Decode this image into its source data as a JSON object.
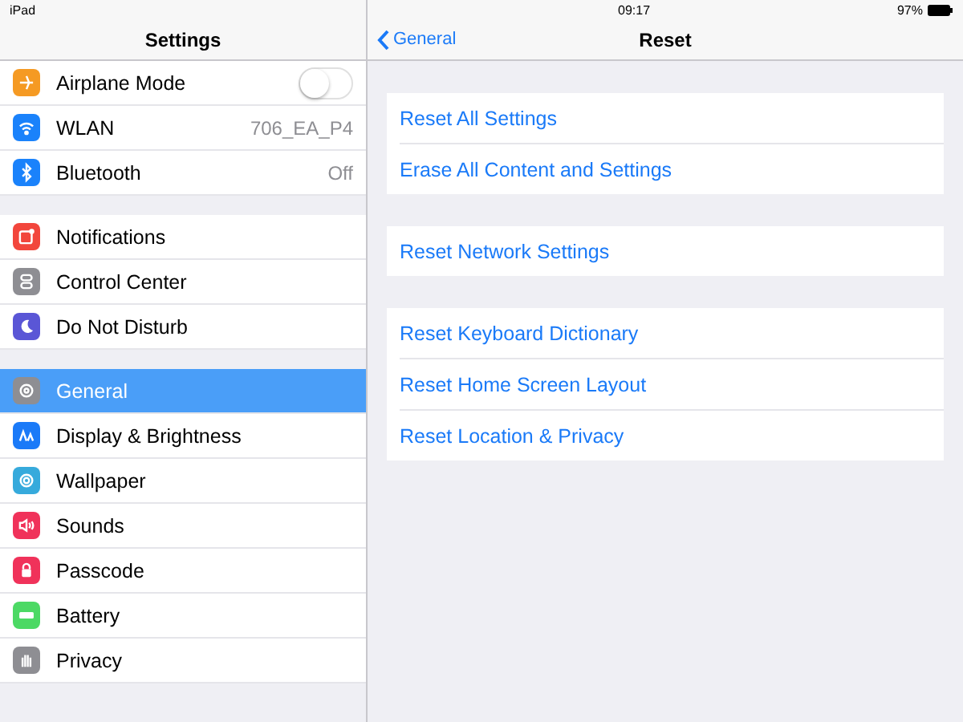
{
  "status_bar": {
    "device": "iPad",
    "time": "09:17",
    "battery": "97%"
  },
  "sidebar": {
    "title": "Settings",
    "sections": [
      [
        {
          "kind": "toggle",
          "color": "#f59a23",
          "label": "Airplane Mode",
          "on": false
        },
        {
          "kind": "value",
          "color": "#1a82fb",
          "label": "WLAN",
          "value": "706_EA_P4"
        },
        {
          "kind": "value",
          "color": "#1a82fb",
          "label": "Bluetooth",
          "value": "Off"
        }
      ],
      [
        {
          "kind": "plain",
          "color": "#f2463c",
          "label": "Notifications"
        },
        {
          "kind": "plain",
          "color": "#8e8e93",
          "label": "Control Center"
        },
        {
          "kind": "plain",
          "color": "#5a56d6",
          "label": "Do Not Disturb"
        }
      ],
      [
        {
          "kind": "plain",
          "color": "#8e8e93",
          "label": "General",
          "selected": true
        },
        {
          "kind": "plain",
          "color": "#1a7af8",
          "label": "Display & Brightness",
          "selected": false
        },
        {
          "kind": "plain",
          "color": "#36aadc",
          "label": "Wallpaper",
          "selected": false
        },
        {
          "kind": "plain",
          "color": "#f0325a",
          "label": "Sounds",
          "selected": false
        },
        {
          "kind": "plain",
          "color": "#f0325a",
          "label": "Passcode",
          "selected": false
        },
        {
          "kind": "plain",
          "color": "#4cd964",
          "label": "Battery",
          "selected": false
        },
        {
          "kind": "plain",
          "color": "#8e8e93",
          "label": "Privacy",
          "selected": false
        }
      ]
    ]
  },
  "detail": {
    "back": "General",
    "title": "Reset",
    "groups": [
      [
        "Reset All Settings",
        "Erase All Content and Settings"
      ],
      [
        "Reset Network Settings"
      ],
      [
        "Reset Keyboard Dictionary",
        "Reset Home Screen Layout",
        "Reset Location & Privacy"
      ]
    ]
  }
}
